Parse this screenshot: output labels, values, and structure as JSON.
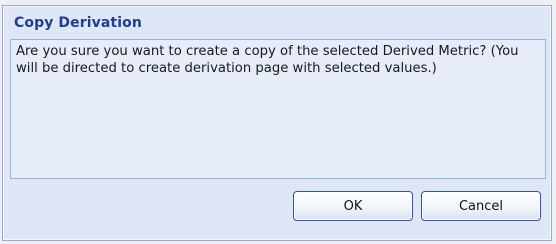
{
  "dialog": {
    "title": "Copy Derivation",
    "message": "Are you sure you want to create a copy of the selected Derived Metric? (You will be directed to create derivation page with selected values.)",
    "ok_label": "OK",
    "cancel_label": "Cancel"
  },
  "colors": {
    "title_text": "#1c3e94",
    "dialog_background": "#dfe7f6",
    "message_background": "#e6ecf8",
    "button_border": "#2b56b3"
  }
}
